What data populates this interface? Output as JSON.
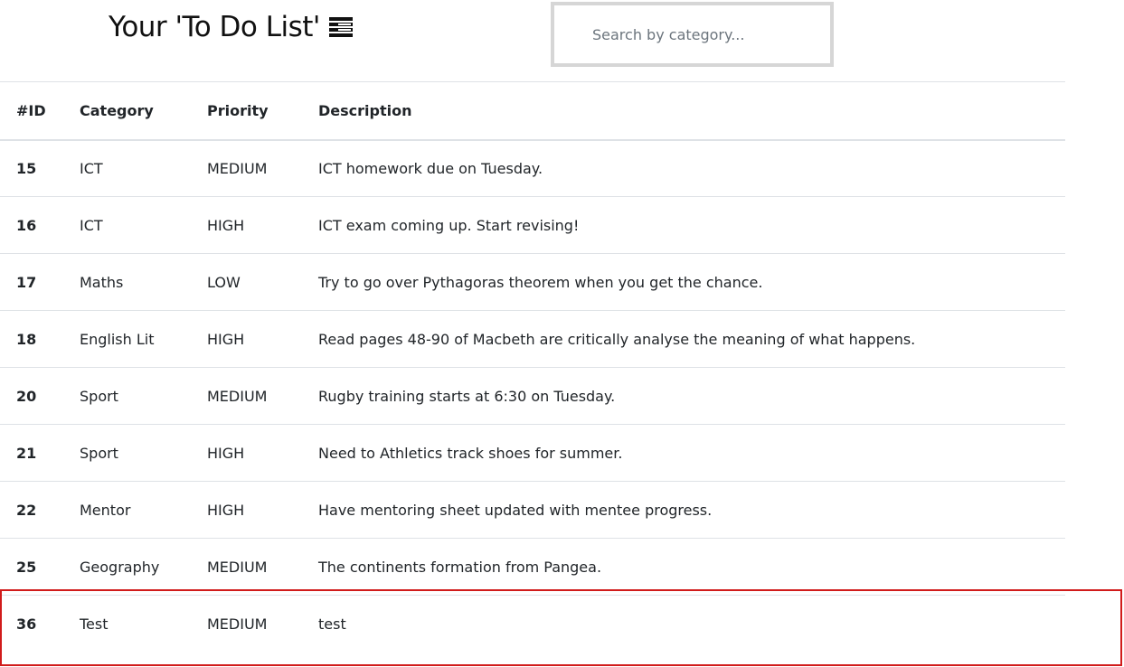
{
  "page": {
    "title": "Your 'To Do List'",
    "title_icon": "list-icon"
  },
  "search": {
    "placeholder": "Search by category...",
    "value": ""
  },
  "table": {
    "headers": {
      "id": "#ID",
      "category": "Category",
      "priority": "Priority",
      "description": "Description"
    },
    "rows": [
      {
        "id": "15",
        "category": "ICT",
        "priority": "MEDIUM",
        "description": "ICT homework due on Tuesday."
      },
      {
        "id": "16",
        "category": "ICT",
        "priority": "HIGH",
        "description": "ICT exam coming up. Start revising!"
      },
      {
        "id": "17",
        "category": "Maths",
        "priority": "LOW",
        "description": "Try to go over Pythagoras theorem when you get the chance."
      },
      {
        "id": "18",
        "category": "English Lit",
        "priority": "HIGH",
        "description": "Read pages 48-90 of Macbeth are critically analyse the meaning of what happens."
      },
      {
        "id": "20",
        "category": "Sport",
        "priority": "MEDIUM",
        "description": "Rugby training starts at 6:30 on Tuesday."
      },
      {
        "id": "21",
        "category": "Sport",
        "priority": "HIGH",
        "description": "Need to Athletics track shoes for summer."
      },
      {
        "id": "22",
        "category": "Mentor",
        "priority": "HIGH",
        "description": "Have mentoring sheet updated with mentee progress."
      },
      {
        "id": "25",
        "category": "Geography",
        "priority": "MEDIUM",
        "description": "The continents formation from Pangea."
      },
      {
        "id": "36",
        "category": "Test",
        "priority": "MEDIUM",
        "description": "test"
      }
    ]
  },
  "colors": {
    "highlight_border": "#d11b1b",
    "search_border": "#d6d6d6",
    "row_divider": "#dee2e6"
  }
}
